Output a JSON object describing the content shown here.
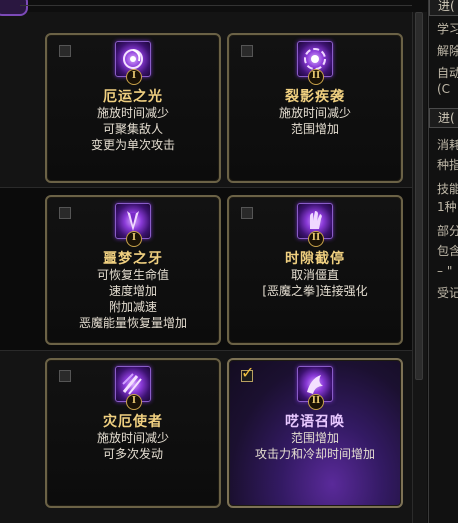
{
  "cards": [
    {
      "title": "厄运之光",
      "tier": "I",
      "checked": false,
      "desc": [
        "施放时间减少",
        "可聚集敌人",
        "变更为单次攻击"
      ]
    },
    {
      "title": "裂影疾袭",
      "tier": "II",
      "checked": false,
      "desc": [
        "施放时间减少",
        "范围增加"
      ]
    },
    {
      "title": "噩梦之牙",
      "tier": "I",
      "checked": false,
      "desc": [
        "可恢复生命值",
        "速度增加",
        "附加减速",
        "恶魔能量恢复量增加"
      ]
    },
    {
      "title": "时隙截停",
      "tier": "II",
      "checked": false,
      "desc": [
        "取消僵直",
        "[恶魔之拳]连接强化"
      ]
    },
    {
      "title": "灾厄使者",
      "tier": "I",
      "checked": false,
      "desc": [
        "施放时间减少",
        "可多次发动"
      ]
    },
    {
      "title": "呓语召唤",
      "tier": "II",
      "checked": true,
      "desc": [
        "范围增加",
        "攻击力和冷却时间增加"
      ]
    }
  ],
  "side_panel": {
    "header1": "进(",
    "lines1": [
      "学习",
      "解除",
      "自动",
      "(C"
    ],
    "header2": "进(",
    "lines2": [
      "消耗",
      "种指",
      "技能",
      "1种",
      "部分",
      "包含",
      "– \"",
      "受记"
    ]
  },
  "colors": {
    "card_border": "#6b6246",
    "title": "#f0d080",
    "selected_glow": "#5a2a9a",
    "accent": "#7c4ab8"
  }
}
